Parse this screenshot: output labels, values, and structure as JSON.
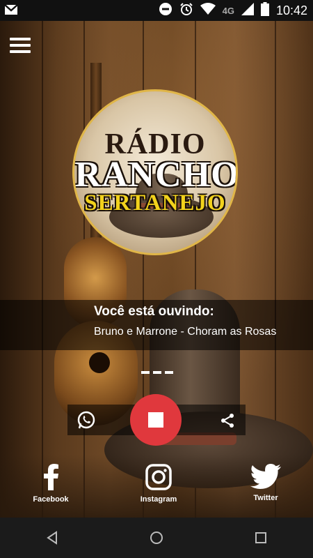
{
  "status_bar": {
    "network": "4G",
    "time": "10:42",
    "icons": [
      "gmail-icon",
      "do-not-disturb-icon",
      "alarm-icon",
      "wifi-icon",
      "signal-icon",
      "battery-icon"
    ]
  },
  "header": {
    "menu_icon": "hamburger-menu-icon"
  },
  "logo": {
    "line1": "RÁDIO",
    "line2": "RANCHO",
    "line3": "SERTANEJO"
  },
  "now_playing": {
    "label": "Você está ouvindo:",
    "track": "Bruno e Marrone - Choram as Rosas"
  },
  "player": {
    "whatsapp_icon": "whatsapp-icon",
    "stop_icon": "stop-icon",
    "share_icon": "share-icon",
    "accent_color": "#e0383d"
  },
  "social": {
    "facebook_label": "Facebook",
    "instagram_label": "Instagram",
    "twitter_label": "Twitter"
  },
  "nav_bar": {
    "icons": [
      "back-icon",
      "home-icon",
      "recents-icon"
    ]
  }
}
